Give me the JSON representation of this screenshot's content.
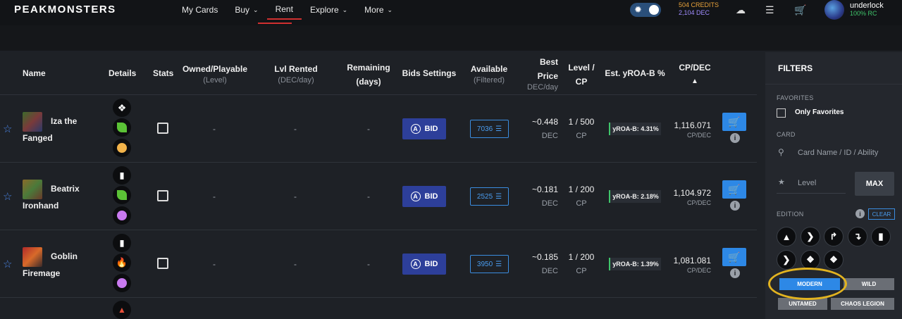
{
  "header": {
    "logo": "PEAKMONSTERS",
    "nav": [
      {
        "label": "My Cards",
        "chevron": false,
        "active": false
      },
      {
        "label": "Buy",
        "chevron": true,
        "active": false
      },
      {
        "label": "Rent",
        "chevron": false,
        "active": true
      },
      {
        "label": "Explore",
        "chevron": true,
        "active": false
      },
      {
        "label": "More",
        "chevron": true,
        "active": false
      }
    ],
    "credits": "504 CREDITS",
    "dec": "2,104 DEC",
    "username": "underlock",
    "rc": "100% RC",
    "icons": [
      "theme-toggle-icon",
      "notification-icon",
      "stack-icon",
      "cart-icon"
    ]
  },
  "table": {
    "columns": {
      "name": "Name",
      "details": "Details",
      "stats": "Stats",
      "owned": "Owned/Playable",
      "owned_sub": "(Level)",
      "lvl_rented": "Lvl Rented",
      "lvl_rented_sub": "(DEC/day)",
      "remaining": "Remaining",
      "remaining_sub": "(days)",
      "bids": "Bids Settings",
      "available": "Available",
      "available_sub": "(Filtered)",
      "best_price": "Best",
      "best_price2": "Price",
      "best_price_sub": "DEC/day",
      "level_cp": "Level /",
      "level_cp2": "CP",
      "yroa": "Est. yROA-B %",
      "cpdec": "CP/DEC",
      "sort_icon": "sort-up-icon"
    },
    "rows": [
      {
        "name1": "Iza the",
        "name2": "Fanged",
        "owned": "-",
        "rented": "-",
        "remaining": "-",
        "bid": "BID",
        "available": "7036",
        "price": "~0.448",
        "price_unit": "DEC",
        "level": "1 / 500",
        "level_unit": "CP",
        "yroa": "yROA-B: 4.31%",
        "cp": "1,116.071",
        "cp_unit": "CP/DEC",
        "details": [
          "tactics",
          "earth",
          "gold"
        ]
      },
      {
        "name1": "Beatrix",
        "name2": "Ironhand",
        "owned": "-",
        "rented": "-",
        "remaining": "-",
        "bid": "BID",
        "available": "2525",
        "price": "~0.181",
        "price_unit": "DEC",
        "level": "1 / 200",
        "level_unit": "CP",
        "yroa": "yROA-B: 2.18%",
        "cp": "1,104.972",
        "cp_unit": "CP/DEC",
        "details": [
          "chaos",
          "earth",
          "purple"
        ]
      },
      {
        "name1": "Goblin",
        "name2": "Firemage",
        "owned": "-",
        "rented": "-",
        "remaining": "-",
        "bid": "BID",
        "available": "3950",
        "price": "~0.185",
        "price_unit": "DEC",
        "level": "1 / 200",
        "level_unit": "CP",
        "yroa": "yROA-B: 1.39%",
        "cp": "1,081.081",
        "cp_unit": "CP/DEC",
        "details": [
          "chaos",
          "fire",
          "purple"
        ]
      }
    ]
  },
  "filters": {
    "title": "FILTERS",
    "favorites_label": "FAVORITES",
    "only_favorites": "Only Favorites",
    "card_label": "CARD",
    "search_placeholder": "Card Name / ID / Ability",
    "level_placeholder": "Level",
    "max": "MAX",
    "edition_label": "EDITION",
    "clear": "CLEAR",
    "formats": [
      "MODERN",
      "WILD",
      "UNTAMED",
      "CHAOS LEGION"
    ]
  },
  "colors": {
    "accent": "#2d88e6",
    "bid": "#2d3f9a",
    "highlight": "#e2b320",
    "positive": "#3fc46a"
  }
}
